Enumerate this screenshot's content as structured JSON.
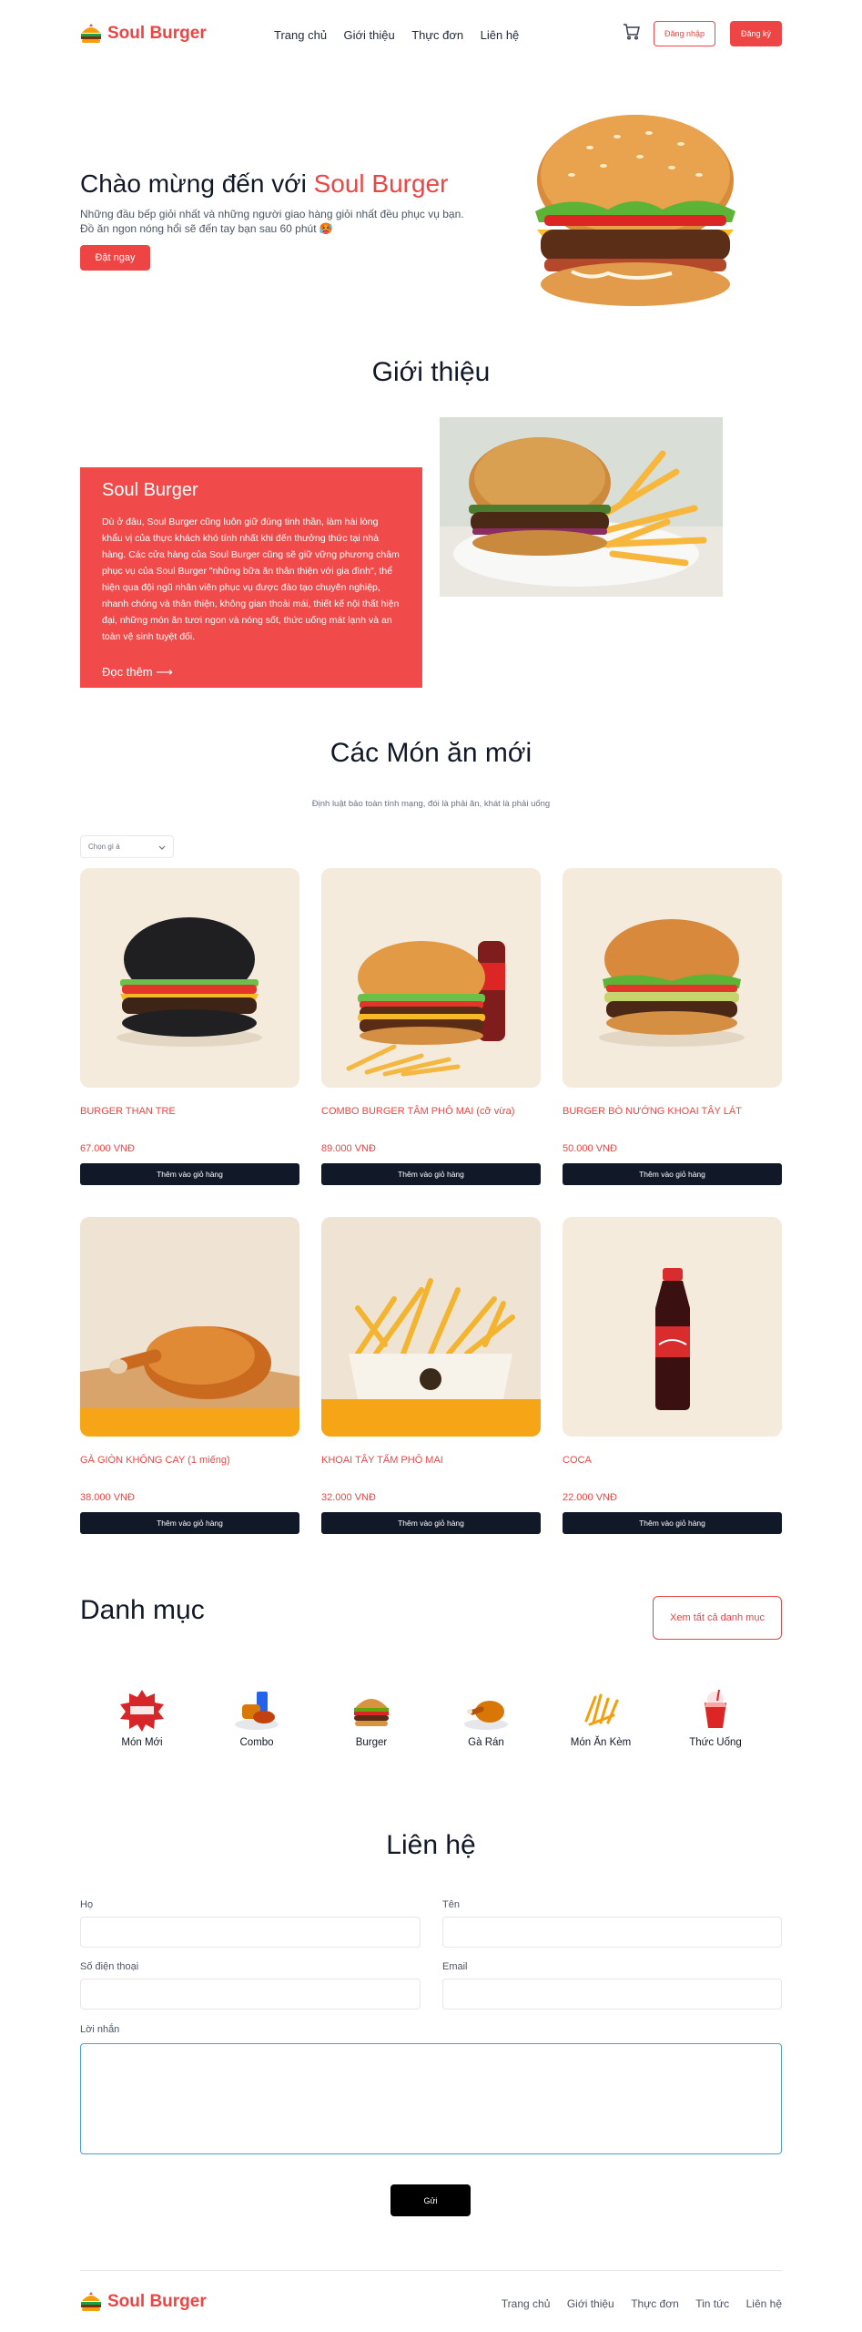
{
  "header": {
    "brand": "Soul Burger",
    "nav": [
      "Trang chủ",
      "Giới thiệu",
      "Thực đơn",
      "Liên hệ"
    ],
    "login_label": "Đăng nhập",
    "register_label": "Đăng ký"
  },
  "hero": {
    "title_prefix": "Chào mừng đến với ",
    "title_brand": "Soul Burger",
    "line1": "Những đầu bếp giỏi nhất và những người giao hàng giỏi nhất đều phục vụ bạn.",
    "line2": "Đồ ăn ngon nóng hổi sẽ đến tay bạn sau 60 phút 🥵",
    "cta_label": "Đặt ngay"
  },
  "about": {
    "title": "Giới thiệu",
    "card_title": "Soul Burger",
    "body": "Dù ở đâu, Soul Burger cũng luôn giữ đúng tinh thần, làm hài lòng khẩu vị của thực khách khó tính nhất khi đến thưởng thức tại nhà hàng. Các cửa hàng của Soul Burger cũng sẽ giữ vững phương châm phục vụ của Soul Burger \"những bữa ăn thân thiện với gia đình\", thể hiện qua đội ngũ nhân viên phục vụ được đào tạo chuyên nghiệp, nhanh chóng và thân thiện, không gian thoải mái, thiết kế nội thất hiện đại, những món ăn tươi ngon và nóng sốt, thức uống mát lạnh và an toàn vệ sinh tuyệt đối.",
    "more_label": "Đọc thêm ⟶"
  },
  "menu": {
    "title": "Các Món ăn mới",
    "subtitle": "Định luật bảo toàn tính mạng, đói là phải ăn, khát là phải uống",
    "select_placeholder": "Chọn gì á",
    "add_label": "Thêm vào giỏ hàng",
    "products": [
      {
        "name": "BURGER THAN TRE",
        "price": "67.000 VNĐ"
      },
      {
        "name": "COMBO BURGER TÂM PHÔ MAI (cỡ vừa)",
        "price": "89.000 VNĐ"
      },
      {
        "name": "BURGER BÒ NƯỚNG KHOAI TÂY LÁT",
        "price": "50.000 VNĐ"
      },
      {
        "name": "GÀ GIÒN KHÔNG CAY (1 miếng)",
        "price": "38.000 VNĐ"
      },
      {
        "name": "KHOAI TÂY TẨM PHÔ MAI",
        "price": "32.000 VNĐ"
      },
      {
        "name": "COCA",
        "price": "22.000 VNĐ"
      }
    ]
  },
  "categories": {
    "title": "Danh mục",
    "view_all_label": "Xem tất cả danh mục",
    "items": [
      {
        "label": "Món Mới",
        "icon": "new-badge-icon"
      },
      {
        "label": "Combo",
        "icon": "combo-icon"
      },
      {
        "label": "Burger",
        "icon": "burger-icon"
      },
      {
        "label": "Gà Rán",
        "icon": "fried-chicken-icon"
      },
      {
        "label": "Món Ăn Kèm",
        "icon": "fries-icon"
      },
      {
        "label": "Thức Uống",
        "icon": "drink-icon"
      }
    ]
  },
  "contact": {
    "title": "Liên hệ",
    "last_name_label": "Họ",
    "first_name_label": "Tên",
    "phone_label": "Số điện thoại",
    "email_label": "Email",
    "message_label": "Lời nhắn",
    "submit_label": "Gửi"
  },
  "footer": {
    "brand": "Soul Burger",
    "nav": [
      "Trang chủ",
      "Giới thiệu",
      "Thực đơn",
      "Tin tức",
      "Liên hệ"
    ]
  },
  "colors": {
    "accent": "#ef4444",
    "dark": "#111827"
  }
}
